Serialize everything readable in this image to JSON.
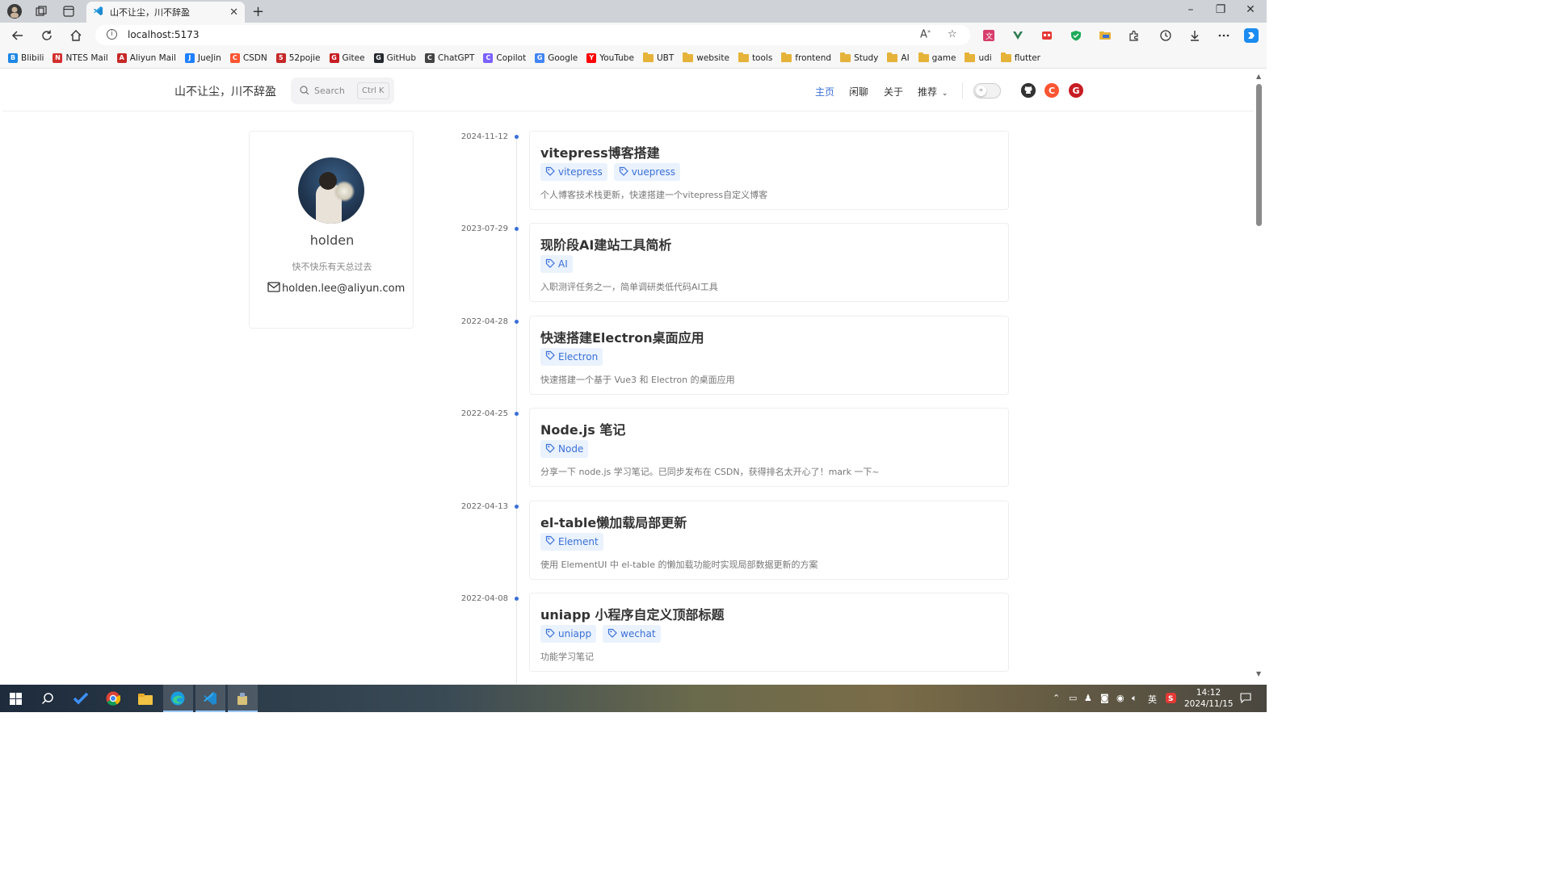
{
  "browser": {
    "tab_title": "山不让尘，川不辞盈",
    "url": "localhost:5173",
    "read_aloud_icon": "A!"
  },
  "bookmarks": [
    {
      "label": "Blibili",
      "icon": "bilibili-icon",
      "color": "#1e88e5"
    },
    {
      "label": "NTES Mail",
      "icon": "netease-mail-icon",
      "color": "#d32f2f"
    },
    {
      "label": "Aliyun Mail",
      "icon": "aliyun-mail-icon",
      "color": "#c62828"
    },
    {
      "label": "JueJin",
      "icon": "juejin-icon",
      "color": "#1e80ff"
    },
    {
      "label": "CSDN",
      "icon": "csdn-icon",
      "color": "#fc5531"
    },
    {
      "label": "52pojie",
      "icon": "52pojie-icon",
      "color": "#c62828"
    },
    {
      "label": "Gitee",
      "icon": "gitee-icon",
      "color": "#c71d23"
    },
    {
      "label": "GitHub",
      "icon": "github-icon",
      "color": "#24292f"
    },
    {
      "label": "ChatGPT",
      "icon": "chatgpt-icon",
      "color": "#444444"
    },
    {
      "label": "Copilot",
      "icon": "copilot-icon",
      "color": "#7b61ff"
    },
    {
      "label": "Google",
      "icon": "google-icon",
      "color": "#4285f4"
    },
    {
      "label": "YouTube",
      "icon": "youtube-icon",
      "color": "#ff0000"
    },
    {
      "label": "UBT",
      "icon": "folder-icon"
    },
    {
      "label": "website",
      "icon": "folder-icon"
    },
    {
      "label": "tools",
      "icon": "folder-icon"
    },
    {
      "label": "frontend",
      "icon": "folder-icon"
    },
    {
      "label": "Study",
      "icon": "folder-icon"
    },
    {
      "label": "AI",
      "icon": "folder-icon"
    },
    {
      "label": "game",
      "icon": "folder-icon"
    },
    {
      "label": "udi",
      "icon": "folder-icon"
    },
    {
      "label": "flutter",
      "icon": "folder-icon"
    }
  ],
  "site": {
    "title": "山不让尘，川不辞盈",
    "search_placeholder": "Search",
    "search_shortcut": "Ctrl K",
    "nav": [
      {
        "label": "主页",
        "active": true
      },
      {
        "label": "闲聊",
        "active": false
      },
      {
        "label": "关于",
        "active": false
      },
      {
        "label": "推荐",
        "active": false
      }
    ],
    "accent_color": "#3a70d8"
  },
  "profile": {
    "name": "holden",
    "motto": "快不快乐有天总过去",
    "email": "holden.lee@aliyun.com"
  },
  "posts": [
    {
      "date": "2024-11-12",
      "title": "vitepress博客搭建",
      "tags": [
        "vitepress",
        "vuepress"
      ],
      "desc": "个人博客技术栈更新，快速搭建一个vitepress自定义博客"
    },
    {
      "date": "2023-07-29",
      "title": "现阶段AI建站工具简析",
      "tags": [
        "AI"
      ],
      "desc": "入职测评任务之一，简单调研类低代码AI工具"
    },
    {
      "date": "2022-04-28",
      "title": "快速搭建Electron桌面应用",
      "tags": [
        "Electron"
      ],
      "desc": "快速搭建一个基于 Vue3 和 Electron 的桌面应用"
    },
    {
      "date": "2022-04-25",
      "title": "Node.js 笔记",
      "tags": [
        "Node"
      ],
      "desc": "分享一下 node.js 学习笔记。已同步发布在 CSDN，获得排名太开心了！mark 一下~"
    },
    {
      "date": "2022-04-13",
      "title": "el-table懒加载局部更新",
      "tags": [
        "Element"
      ],
      "desc": "使用 ElementUI 中 el-table 的懒加载功能时实现局部数据更新的方案"
    },
    {
      "date": "2022-04-08",
      "title": "uniapp 小程序自定义顶部标题",
      "tags": [
        "uniapp",
        "wechat"
      ],
      "desc": "功能学习笔记"
    }
  ],
  "taskbar": {
    "time": "14:12",
    "date": "2024/11/15",
    "ime": "英"
  }
}
